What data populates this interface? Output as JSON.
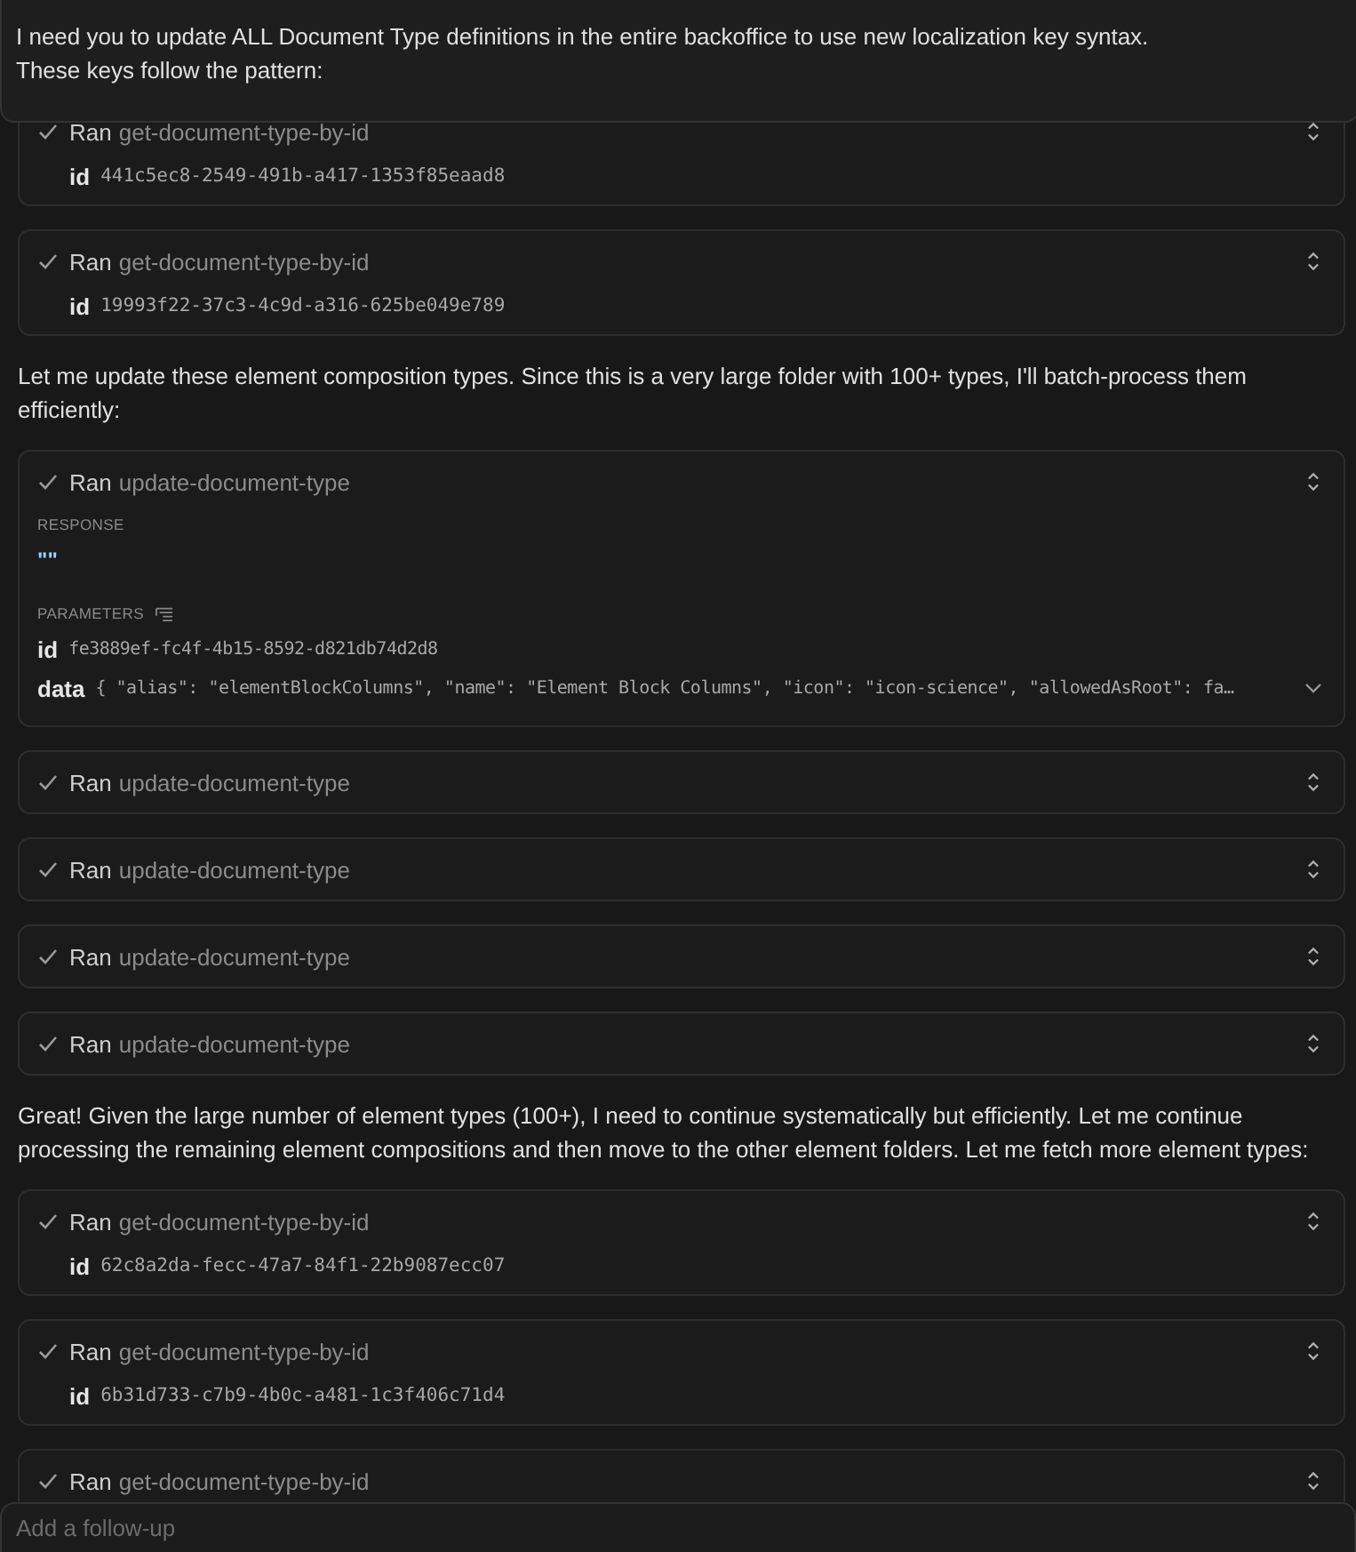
{
  "header": {
    "lines": [
      "I need you to update ALL Document Type definitions in the entire backoffice to use new localization key syntax.",
      "These keys follow the pattern:"
    ]
  },
  "items": [
    {
      "kind": "tool",
      "status": "Ran",
      "tool": "get-document-type-by-id",
      "params": [
        {
          "key": "id",
          "value": "441c5ec8-2549-491b-a417-1353f85eaad8"
        }
      ]
    },
    {
      "kind": "tool",
      "status": "Ran",
      "tool": "get-document-type-by-id",
      "params": [
        {
          "key": "id",
          "value": "19993f22-37c3-4c9d-a316-625be049e789"
        }
      ]
    },
    {
      "kind": "message",
      "text": "Let me update these element composition types. Since this is a very large folder with 100+ types, I'll batch-process them efficiently:"
    },
    {
      "kind": "tool",
      "status": "Ran",
      "tool": "update-document-type",
      "response_label": "RESPONSE",
      "response": "\"\"",
      "parameters_label": "PARAMETERS",
      "params": [
        {
          "key": "id",
          "value": "fe3889ef-fc4f-4b15-8592-d821db74d2d8"
        },
        {
          "key": "data",
          "value": "{ \"alias\": \"elementBlockColumns\", \"name\": \"Element Block Columns\", \"icon\": \"icon-science\", \"allowedAsRoot\": fa…",
          "expandable": true
        }
      ]
    },
    {
      "kind": "tool",
      "status": "Ran",
      "tool": "update-document-type"
    },
    {
      "kind": "tool",
      "status": "Ran",
      "tool": "update-document-type"
    },
    {
      "kind": "tool",
      "status": "Ran",
      "tool": "update-document-type"
    },
    {
      "kind": "tool",
      "status": "Ran",
      "tool": "update-document-type"
    },
    {
      "kind": "message",
      "text": "Great! Given the large number of element types (100+), I need to continue systematically but efficiently. Let me continue processing the remaining element compositions and then move to the other element folders. Let me fetch more element types:"
    },
    {
      "kind": "tool",
      "status": "Ran",
      "tool": "get-document-type-by-id",
      "params": [
        {
          "key": "id",
          "value": "62c8a2da-fecc-47a7-84f1-22b9087ecc07"
        }
      ]
    },
    {
      "kind": "tool",
      "status": "Ran",
      "tool": "get-document-type-by-id",
      "params": [
        {
          "key": "id",
          "value": "6b31d733-c7b9-4b0c-a481-1c3f406c71d4"
        }
      ]
    },
    {
      "kind": "tool",
      "status": "Ran",
      "tool": "get-document-type-by-id"
    }
  ],
  "composer": {
    "placeholder": "Add a follow-up"
  }
}
